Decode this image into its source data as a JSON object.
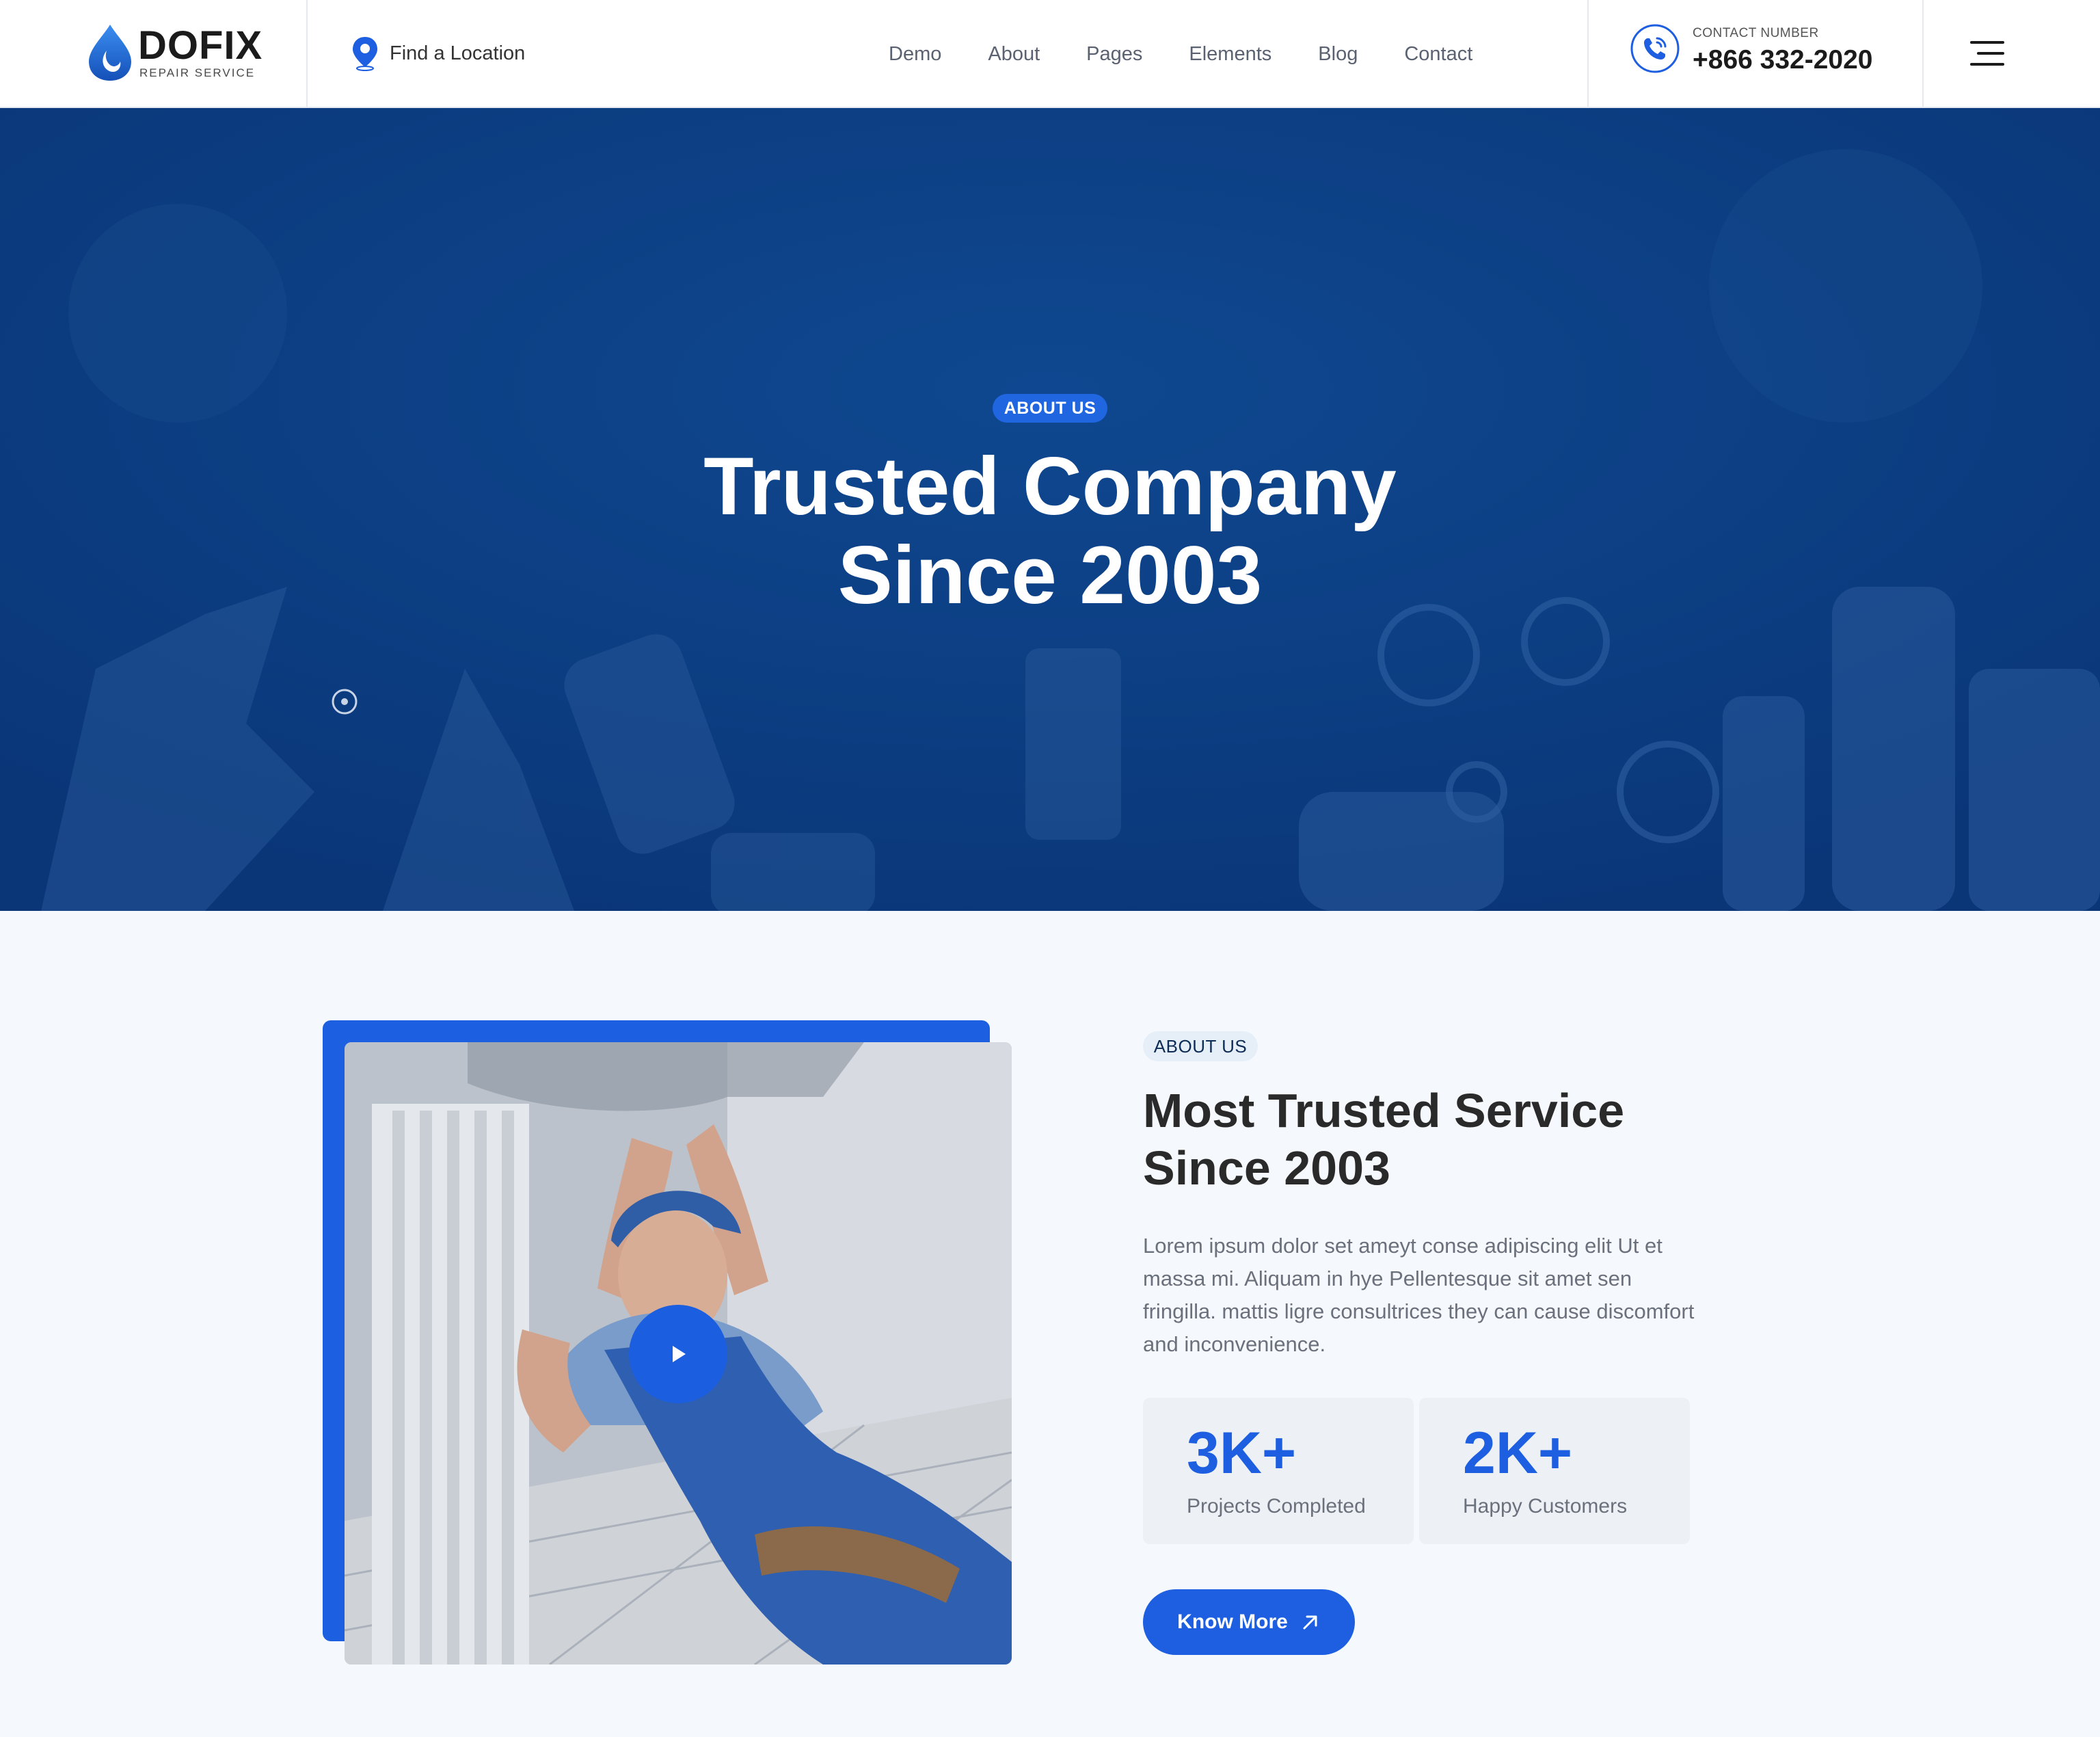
{
  "header": {
    "logo": {
      "name": "DOFIX",
      "tagline": "REPAIR SERVICE"
    },
    "find_location": "Find a Location",
    "nav": [
      "Demo",
      "About",
      "Pages",
      "Elements",
      "Blog",
      "Contact"
    ],
    "contact": {
      "label": "CONTACT NUMBER",
      "number": "+866 332-2020"
    }
  },
  "hero": {
    "tag": "ABOUT US",
    "title_line1": "Trusted Company",
    "title_line2": "Since 2003"
  },
  "about": {
    "tag": "ABOUT US",
    "title_line1": "Most Trusted Service",
    "title_line2": "Since 2003",
    "body": "Lorem ipsum dolor set ameyt conse adipiscing elit Ut et massa mi. Aliquam in hye Pellentesque sit amet sen fringilla. mattis ligre consultrices they can cause discomfort and inconvenience.",
    "stats": [
      {
        "value": "3K+",
        "label": "Projects Completed"
      },
      {
        "value": "2K+",
        "label": "Happy Customers"
      }
    ],
    "button": "Know More"
  },
  "colors": {
    "primary": "#1d5fe0",
    "hero_bg": "#0c3f85",
    "page_bg": "#f5f8fc"
  },
  "icons": [
    "water-drop-logo-icon",
    "location-pin-icon",
    "phone-call-icon",
    "hamburger-menu-icon",
    "target-dot-icon",
    "play-icon",
    "arrow-up-right-icon"
  ]
}
